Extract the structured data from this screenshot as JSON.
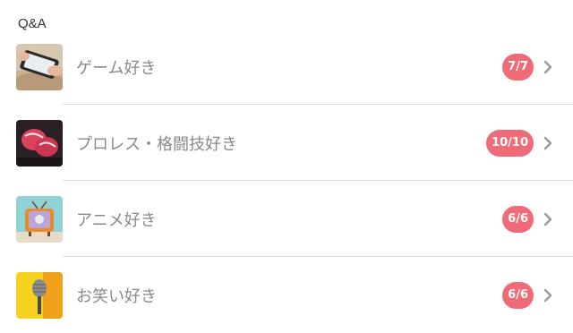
{
  "section": {
    "title": "Q&A"
  },
  "items": [
    {
      "label": "ゲーム好き",
      "badge": "7/7",
      "icon": "smartphone-game-photo-icon"
    },
    {
      "label": "プロレス・格闘技好き",
      "badge": "10/10",
      "icon": "boxing-gloves-photo-icon"
    },
    {
      "label": "アニメ好き",
      "badge": "6/6",
      "icon": "retro-tv-photo-icon"
    },
    {
      "label": "お笑い好き",
      "badge": "6/6",
      "icon": "microphone-photo-icon"
    }
  ],
  "colors": {
    "badge": "#ef6b77",
    "label": "#8a8a8a",
    "divider": "#dddddd",
    "chevron": "#9a9a9a"
  }
}
